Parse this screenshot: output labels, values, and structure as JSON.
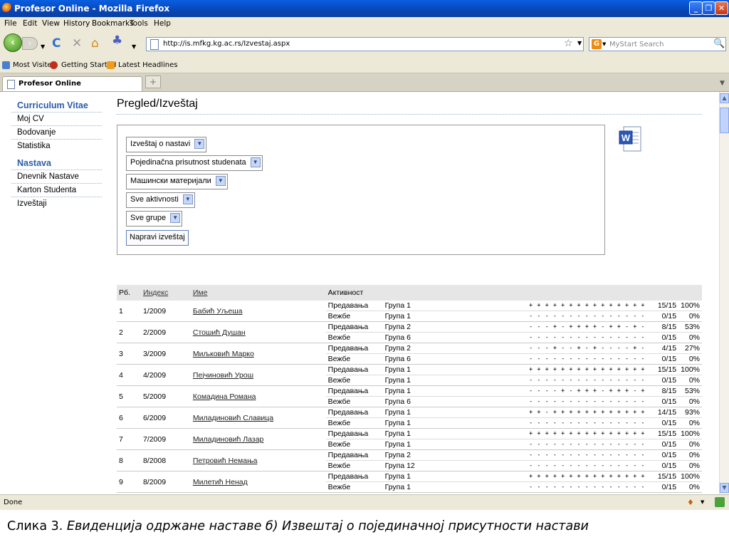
{
  "window": {
    "title": "Profesor Online - Mozilla Firefox",
    "min": "_",
    "restore": "❐",
    "close": "✕"
  },
  "menu": [
    "File",
    "Edit",
    "View",
    "History",
    "Bookmarks",
    "Tools",
    "Help"
  ],
  "nav": {
    "back": "‹",
    "forward": "›",
    "reload": "C",
    "stop": "✕",
    "home": "⌂",
    "addon": "♣",
    "url": "http://is.mfkg.kg.ac.rs/Izvestaj.aspx",
    "star": "☆",
    "search_placeholder": "MyStart Search",
    "search_engine": "G",
    "search_icon": "🔍"
  },
  "bookmarks": [
    "Most Visited",
    "Getting Started",
    "Latest Headlines"
  ],
  "tabs": {
    "active": "Profesor Online",
    "new_tab": "+"
  },
  "sidebar": {
    "section1": "Curriculum Vitae",
    "items1": [
      "Moj CV",
      "Bodovanje",
      "Statistika"
    ],
    "section2": "Nastava",
    "items2": [
      "Dnevnik Nastave",
      "Karton Studenta",
      "Izveštaji"
    ]
  },
  "page": {
    "title": "Pregled/Izveštaj"
  },
  "form": {
    "selects": [
      "Izveštaj o nastavi",
      "Pojedinačna prisutnost studenata",
      "Машински материјали",
      "Sve aktivnosti",
      "Sve grupe"
    ],
    "button": "Napravi izveštaj"
  },
  "table": {
    "headers": [
      "Рб.",
      "Индекс",
      "Име",
      "Активност"
    ],
    "rows": [
      {
        "rb": "1",
        "index": "1/2009",
        "name": "Бабић Уљеша",
        "lines": [
          [
            "Предавања",
            "Група 1",
            "+ + + + + + + + + + + + + + +",
            "15/15",
            "100%"
          ],
          [
            "Вежбе",
            "Група 1",
            "- - - - - - - - - - - - - - -",
            "0/15",
            "0%"
          ]
        ]
      },
      {
        "rb": "2",
        "index": "2/2009",
        "name": "Стошић Душан",
        "lines": [
          [
            "Предавања",
            "Група 2",
            "- - - + - + + + + - + + - + -",
            "8/15",
            "53%"
          ],
          [
            "Вежбе",
            "Група 6",
            "- - - - - - - - - - - - - - -",
            "0/15",
            "0%"
          ]
        ]
      },
      {
        "rb": "3",
        "index": "3/2009",
        "name": "Миљковић Марко",
        "lines": [
          [
            "Предавања",
            "Група 2",
            "- - - + - - + - + - - - - + -",
            "4/15",
            "27%"
          ],
          [
            "Вежбе",
            "Група 6",
            "- - - - - - - - - - - - - - -",
            "0/15",
            "0%"
          ]
        ]
      },
      {
        "rb": "4",
        "index": "4/2009",
        "name": "Пејчиновић Урош",
        "lines": [
          [
            "Предавања",
            "Група 1",
            "+ + + + + + + + + + + + + + +",
            "15/15",
            "100%"
          ],
          [
            "Вежбе",
            "Група 1",
            "- - - - - - - - - - - - - - -",
            "0/15",
            "0%"
          ]
        ]
      },
      {
        "rb": "5",
        "index": "5/2009",
        "name": "Комадина Романа",
        "lines": [
          [
            "Предавања",
            "Група 1",
            "- - - - + - + + + - + + + - +",
            "8/15",
            "53%"
          ],
          [
            "Вежбе",
            "Група 6",
            "- - - - - - - - - - - - - - -",
            "0/15",
            "0%"
          ]
        ]
      },
      {
        "rb": "6",
        "index": "6/2009",
        "name": "Миладиновић Славица",
        "lines": [
          [
            "Предавања",
            "Група 1",
            "+ + - + + + + + + + + + + + +",
            "14/15",
            "93%"
          ],
          [
            "Вежбе",
            "Група 1",
            "- - - - - - - - - - - - - - -",
            "0/15",
            "0%"
          ]
        ]
      },
      {
        "rb": "7",
        "index": "7/2009",
        "name": "Миладиновић Лазар",
        "lines": [
          [
            "Предавања",
            "Група 1",
            "+ + + + + + + + + + + + + + +",
            "15/15",
            "100%"
          ],
          [
            "Вежбе",
            "Група 1",
            "- - - - - - - - - - - - - - -",
            "0/15",
            "0%"
          ]
        ]
      },
      {
        "rb": "8",
        "index": "8/2008",
        "name": "Петровић Немања",
        "lines": [
          [
            "Предавања",
            "Група 2",
            "- - - - - - - - - - - - - - -",
            "0/15",
            "0%"
          ],
          [
            "Вежбе",
            "Група 12",
            "- - - - - - - - - - - - - - -",
            "0/15",
            "0%"
          ]
        ]
      },
      {
        "rb": "9",
        "index": "8/2009",
        "name": "Милетић Ненад",
        "lines": [
          [
            "Предавања",
            "Група 1",
            "+ + + + + + + + + + + + + + +",
            "15/15",
            "100%"
          ],
          [
            "Вежбе",
            "Група 1",
            "- - - - - - - - - - - - - - -",
            "0/15",
            "0%"
          ]
        ]
      }
    ]
  },
  "status": {
    "text": "Done"
  },
  "caption": {
    "prefix": "Слика 3. ",
    "text": "Евиденција одржане наставе б) Извештај о појединачној присутности настави"
  }
}
